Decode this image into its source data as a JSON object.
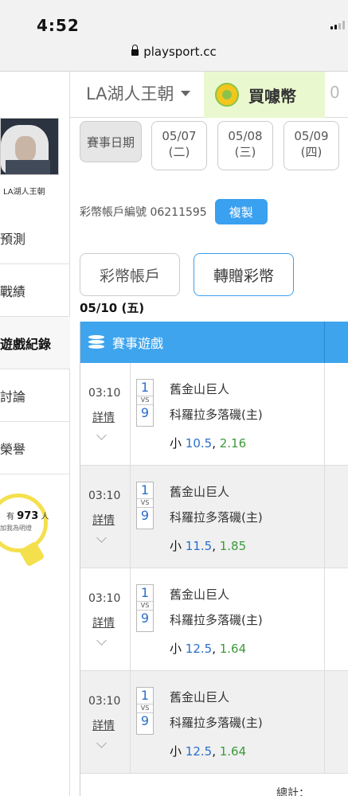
{
  "status": {
    "time": "4:52",
    "url": "playsport.cc"
  },
  "sidebar": {
    "user_name": "LA湖人王朝",
    "items": [
      {
        "label": "預測"
      },
      {
        "label": "戰績"
      },
      {
        "label": "遊戲紀錄"
      },
      {
        "label": "討論"
      },
      {
        "label": "榮譽"
      }
    ],
    "bulb": {
      "count": "973",
      "unit": "人",
      "prefix": "有",
      "sub": "加我為明燈"
    }
  },
  "header": {
    "team": "LA湖人王朝",
    "buy_coin": "買噱幣",
    "cut_text": "0"
  },
  "dates": {
    "label": "賽事日期",
    "items": [
      {
        "date": "05/07",
        "weekday": "(二)"
      },
      {
        "date": "05/08",
        "weekday": "(三)"
      },
      {
        "date": "05/09",
        "weekday": "(四)"
      }
    ]
  },
  "account": {
    "label": "彩幣帳戶編號 06211595",
    "copy_button": "複製"
  },
  "tabs": {
    "account": "彩幣帳戶",
    "transfer": "轉贈彩幣"
  },
  "day": "05/10 (五)",
  "table": {
    "header": "賽事遊戲",
    "rows": [
      {
        "time": "03:10",
        "detail": "詳情",
        "n1": "1",
        "vs": "VS",
        "n2": "9",
        "team1": "舊金山巨人",
        "team2": "科羅拉多落磯(主)",
        "bet_side": "小",
        "bet_line": "10.5",
        "bet_odds": "2.16"
      },
      {
        "time": "03:10",
        "detail": "詳情",
        "n1": "1",
        "vs": "VS",
        "n2": "9",
        "team1": "舊金山巨人",
        "team2": "科羅拉多落磯(主)",
        "bet_side": "小",
        "bet_line": "11.5",
        "bet_odds": "1.85"
      },
      {
        "time": "03:10",
        "detail": "詳情",
        "n1": "1",
        "vs": "VS",
        "n2": "9",
        "team1": "舊金山巨人",
        "team2": "科羅拉多落磯(主)",
        "bet_side": "小",
        "bet_line": "12.5",
        "bet_odds": "1.64"
      },
      {
        "time": "03:10",
        "detail": "詳情",
        "n1": "1",
        "vs": "VS",
        "n2": "9",
        "team1": "舊金山巨人",
        "team2": "科羅拉多落磯(主)",
        "bet_side": "小",
        "bet_line": "12.5",
        "bet_odds": "1.64"
      }
    ],
    "total_label": "總計："
  },
  "colors": {
    "accent_blue": "#3ea4ee",
    "coin_bg": "#eaf8cf",
    "odds_green": "#3b9a3b",
    "line_blue": "#2b6ec9"
  }
}
